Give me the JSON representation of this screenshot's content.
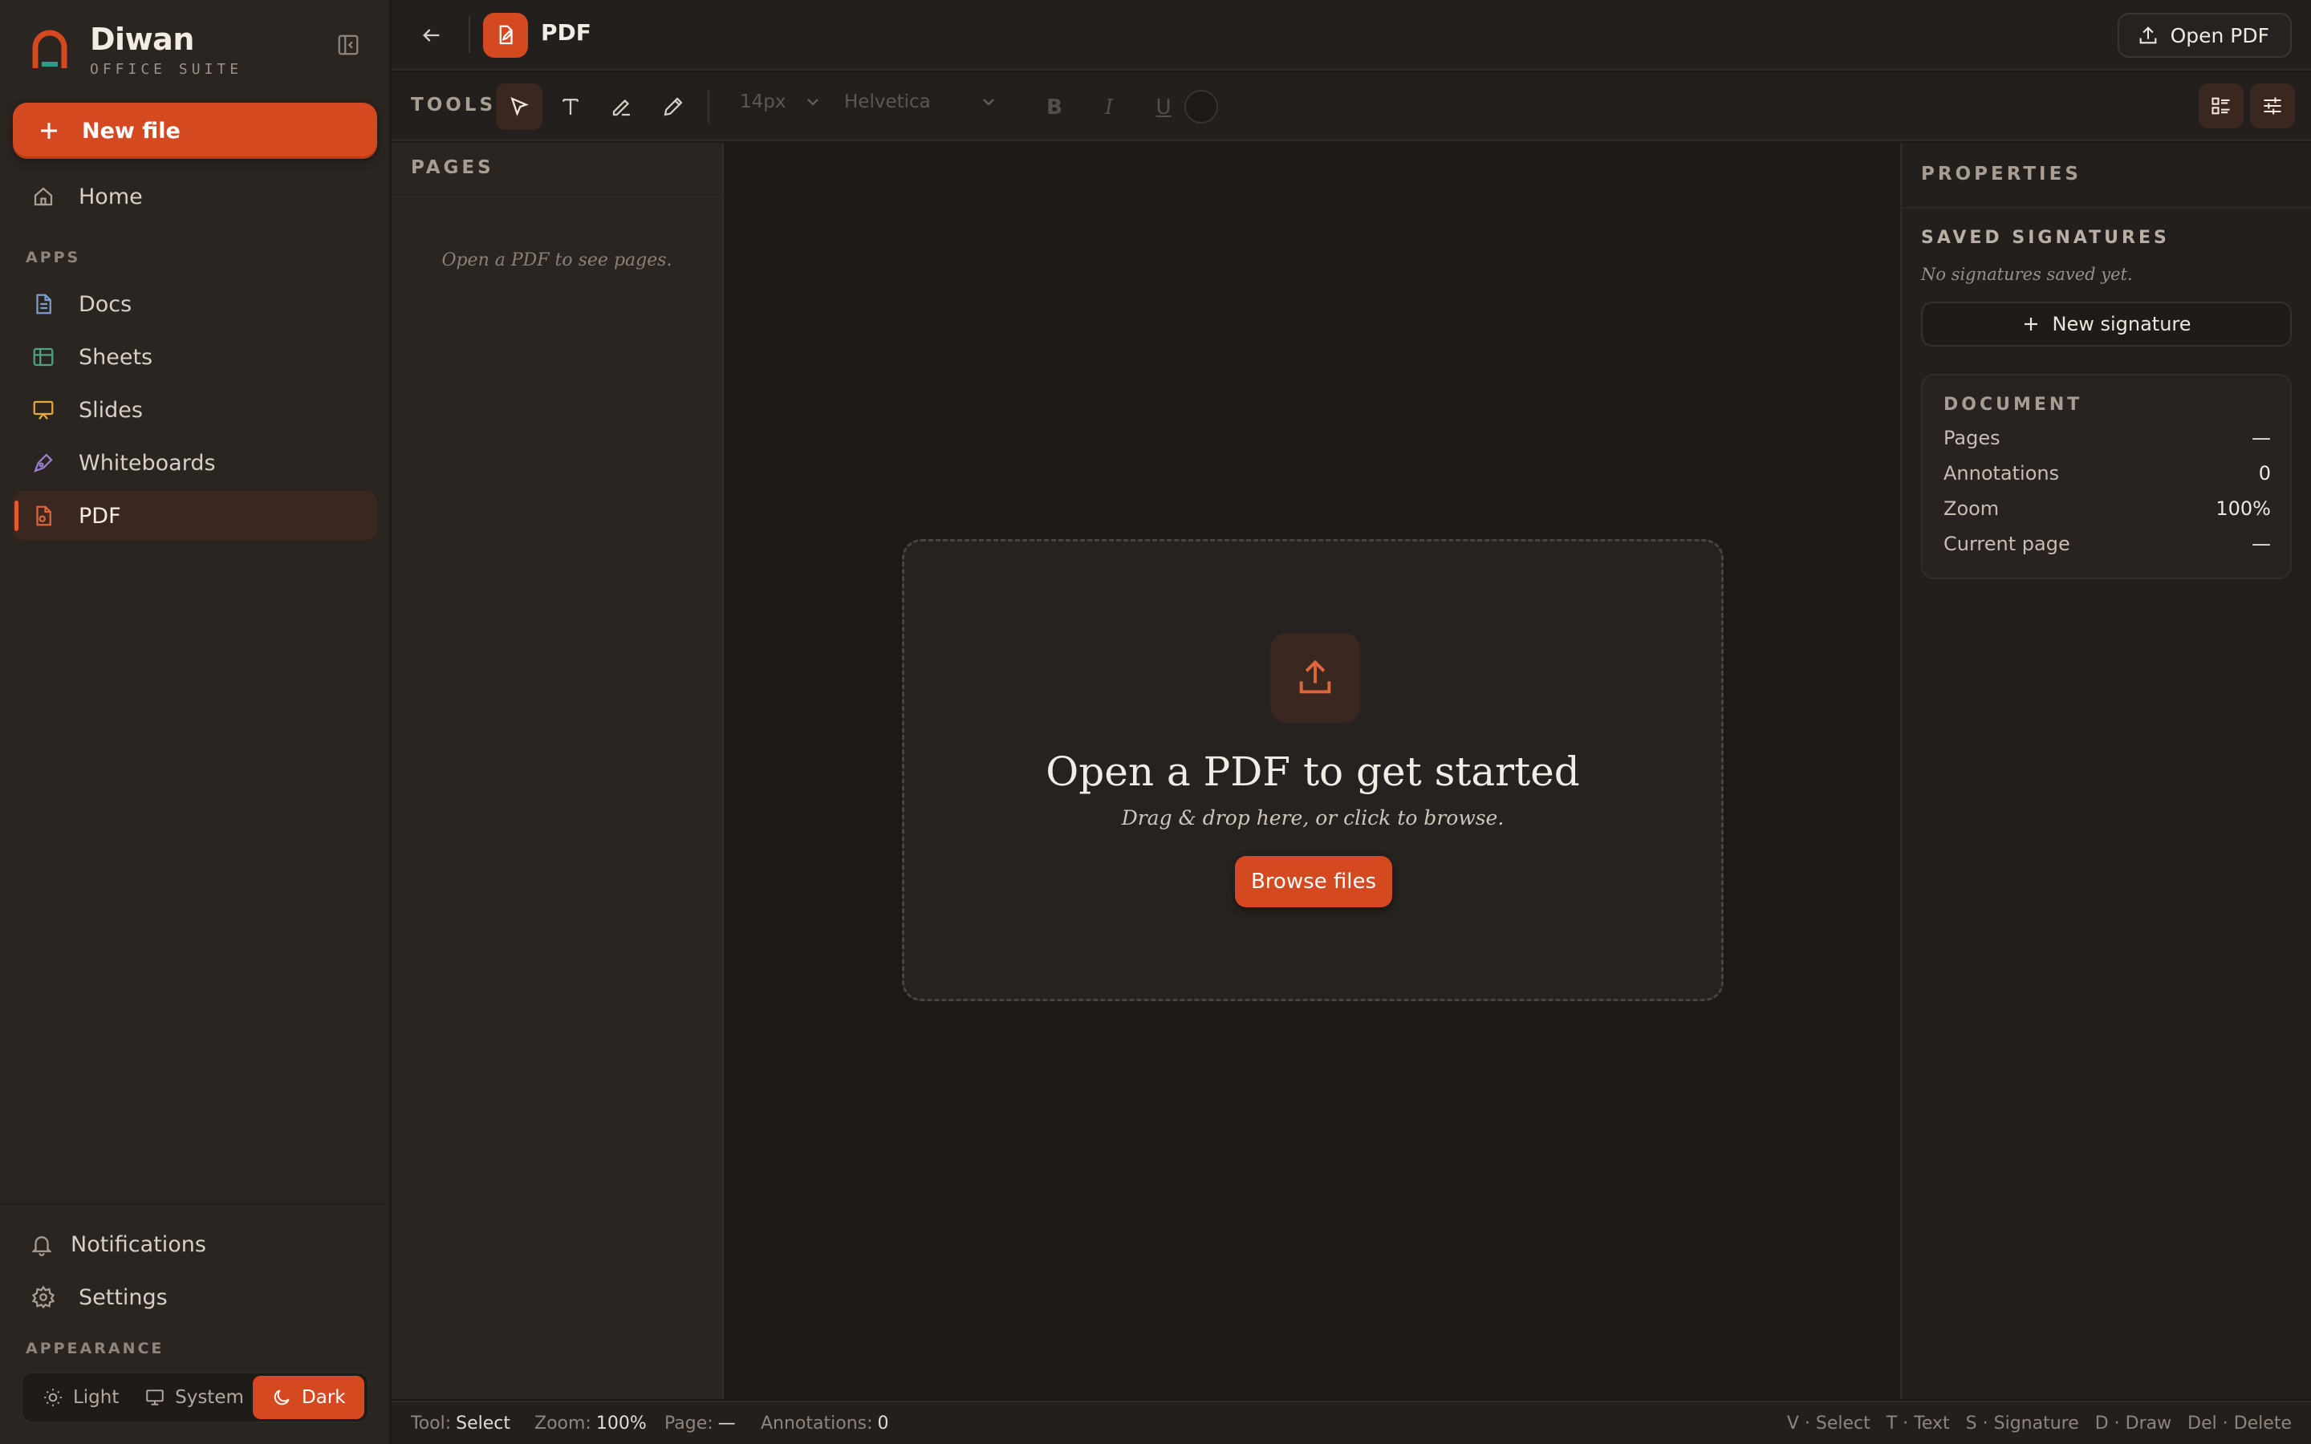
{
  "brand": {
    "name": "Diwan",
    "subtitle": "OFFICE SUITE"
  },
  "sidebar": {
    "new_file_label": "New file",
    "home_label": "Home",
    "apps_section": "APPS",
    "apps": [
      {
        "label": "Docs",
        "icon": "doc-icon",
        "color": "#7b9ccc"
      },
      {
        "label": "Sheets",
        "icon": "table-icon",
        "color": "#4fa383"
      },
      {
        "label": "Slides",
        "icon": "presentation-icon",
        "color": "#e2a93b"
      },
      {
        "label": "Whiteboards",
        "icon": "pen-tool-icon",
        "color": "#9b7fd0"
      },
      {
        "label": "PDF",
        "icon": "pdf-file-icon",
        "color": "#e2643b",
        "active": true
      }
    ],
    "notifications_label": "Notifications",
    "settings_label": "Settings",
    "appearance_section": "APPEARANCE",
    "theme": {
      "options": [
        "Light",
        "System",
        "Dark"
      ],
      "selected": "Dark"
    }
  },
  "topbar": {
    "title": "PDF",
    "open_pdf_label": "Open PDF"
  },
  "toolbar": {
    "tools_label": "TOOLS",
    "tools": [
      "select",
      "text",
      "signature",
      "draw"
    ],
    "active_tool": "select",
    "font_size": "14px",
    "font_family": "Helvetica",
    "bold": "B",
    "italic": "I",
    "underline": "U"
  },
  "pages_panel": {
    "title": "PAGES",
    "empty_text": "Open a PDF to see pages."
  },
  "canvas": {
    "title": "Open a PDF to get started",
    "subtitle": "Drag & drop here, or click to browse.",
    "browse_label": "Browse files"
  },
  "properties": {
    "title": "PROPERTIES",
    "signatures_title": "SAVED SIGNATURES",
    "signatures_empty": "No signatures saved yet.",
    "new_signature_label": "New signature",
    "document_title": "DOCUMENT",
    "document": [
      {
        "label": "Pages",
        "value": "—"
      },
      {
        "label": "Annotations",
        "value": "0"
      },
      {
        "label": "Zoom",
        "value": "100%"
      },
      {
        "label": "Current page",
        "value": "—"
      }
    ]
  },
  "status": {
    "tool_label": "Tool:",
    "tool_value": "Select",
    "zoom_label": "Zoom:",
    "zoom_value": "100%",
    "page_label": "Page:",
    "page_value": "—",
    "annotations_label": "Annotations:",
    "annotations_value": "0",
    "shortcuts": [
      "V · Select",
      "T · Text",
      "S · Signature",
      "D · Draw",
      "Del · Delete"
    ]
  },
  "colors": {
    "accent": "#d4491f",
    "background": "#1c1916",
    "panel": "#2a2521"
  }
}
